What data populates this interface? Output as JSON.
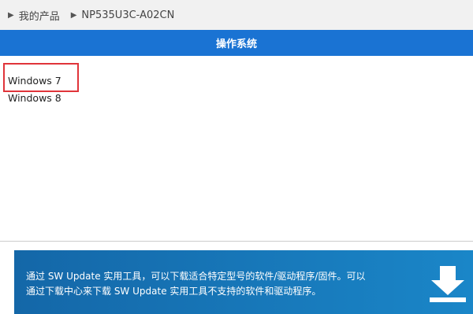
{
  "breadcrumb": {
    "items": [
      {
        "label": "我的产品"
      },
      {
        "label": "NP535U3C-A02CN"
      }
    ],
    "separator_icon": "triangle-right-icon"
  },
  "header": {
    "title": "操作系统",
    "background": "#1a73d3"
  },
  "os_list": {
    "items": [
      {
        "label": "Windows 7",
        "highlighted": true
      },
      {
        "label": "Windows 8",
        "highlighted": false
      }
    ],
    "highlight_color": "#e0343a"
  },
  "banner": {
    "lines": [
      "通过 SW Update 实用工具，可以下载适合特定型号的软件/驱动程序/固件。可以",
      "通过下载中心来下载 SW Update 实用工具不支持的软件和驱动程序。"
    ],
    "icon": "download-icon",
    "background_start": "#1467a8",
    "background_end": "#1a86c8"
  }
}
